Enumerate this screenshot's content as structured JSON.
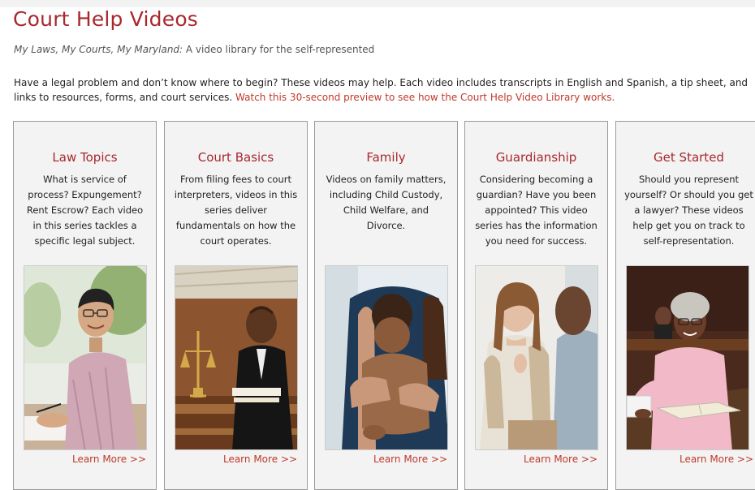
{
  "header": {
    "title": "Court Help Videos",
    "subtitle_italic": "My Laws, My Courts, My Maryland:",
    "subtitle_rest": " A video library for the self-represented"
  },
  "intro": {
    "text": "Have a legal problem and don’t know where to begin? These videos may help. Each video includes transcripts in English and Spanish, a tip sheet, and links to resources, forms, and court services. ",
    "link": "Watch this 30-second preview to see how the Court Help Video Library works."
  },
  "cards": [
    {
      "title": "Law Topics",
      "description": "What is service of process? Expungement? Rent Escrow? Each video in this series tackles a specific legal subject.",
      "link": "Learn More >>"
    },
    {
      "title": "Court Basics",
      "description": "From filing fees to court interpreters, videos in this series deliver fundamentals on how the court operates.",
      "link": "Learn More >>"
    },
    {
      "title": "Family",
      "description": "Videos on family matters, including Child Custody, Child Welfare, and Divorce.",
      "link": "Learn More >>"
    },
    {
      "title": "Guardianship",
      "description": "Considering becoming a guardian? Have you been appointed? This video series has the information you need for success.",
      "link": "Learn More >>"
    },
    {
      "title": "Get Started",
      "description": "Should you represent yourself? Or should you get a lawyer? These videos help get you on track to self-representation.",
      "link": "Learn More >>"
    }
  ],
  "colors": {
    "accent": "#a8282e",
    "link": "#c0392b",
    "card_bg": "#f3f3f3",
    "card_border": "#9a9a9a"
  }
}
